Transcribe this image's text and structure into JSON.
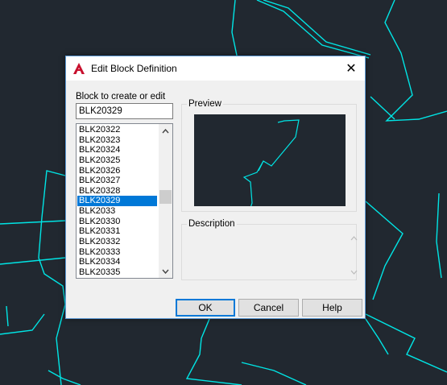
{
  "dialog": {
    "title": "Edit Block Definition",
    "close_glyph": "✕",
    "block_label": "Block to create or edit",
    "block_name_value": "BLK20329",
    "list_items": [
      "BLK20322",
      "BLK20323",
      "BLK20324",
      "BLK20325",
      "BLK20326",
      "BLK20327",
      "BLK20328",
      "BLK20329",
      "BLK2033",
      "BLK20330",
      "BLK20331",
      "BLK20332",
      "BLK20333",
      "BLK20334",
      "BLK20335"
    ],
    "selected_item": "BLK20329",
    "preview_label": "Preview",
    "description_label": "Description",
    "ok_label": "OK",
    "cancel_label": "Cancel",
    "help_label": "Help"
  },
  "colors": {
    "canvas_bg": "#212830",
    "geometry": "#00e5e5",
    "selection": "#0078d7",
    "app_icon": "#c8102e"
  },
  "icons": {
    "app": "autocad-a-icon",
    "scroll_up": "chevron-up-icon",
    "scroll_down": "chevron-down-icon"
  }
}
